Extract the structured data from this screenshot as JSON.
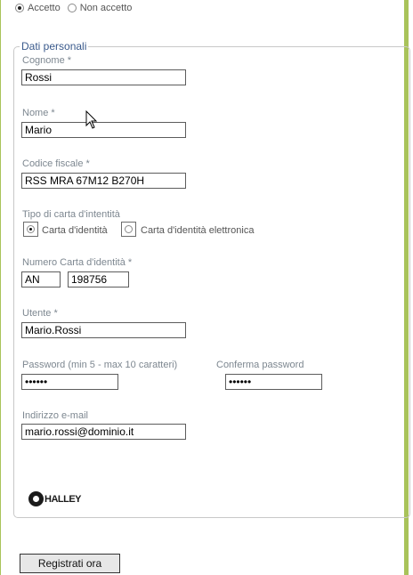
{
  "consent": {
    "accept_label": "Accetto",
    "reject_label": "Non accetto",
    "selected": "Accetto"
  },
  "section_title": "Dati personali",
  "fields": {
    "cognome": {
      "label": "Cognome *",
      "value": "Rossi"
    },
    "nome": {
      "label": "Nome *",
      "value": "Mario"
    },
    "codice_fiscale": {
      "label": "Codice fiscale *",
      "value": "RSS MRA 67M12 B270H"
    },
    "tipo_carta": {
      "label": "Tipo di carta d'intentità",
      "option1": "Carta d'identità",
      "option2": "Carta d'identità elettronica",
      "selected": "Carta d'identità"
    },
    "numero_carta": {
      "label": "Numero Carta d'identità *",
      "prefix": "AN",
      "number": "198756"
    },
    "utente": {
      "label": "Utente *",
      "value": "Mario.Rossi"
    },
    "password": {
      "label": "Password (min 5 - max 10 caratteri)",
      "value": "••••••"
    },
    "conferma_password": {
      "label": "Conferma password",
      "value": "••••••"
    },
    "email": {
      "label": "Indirizzo e-mail",
      "value": "mario.rossi@dominio.it"
    }
  },
  "logo": {
    "text": "HALLEY",
    "icon": "halley-logo-icon"
  },
  "submit_label": "Registrati ora",
  "cursor_icon": "mouse-pointer-icon"
}
